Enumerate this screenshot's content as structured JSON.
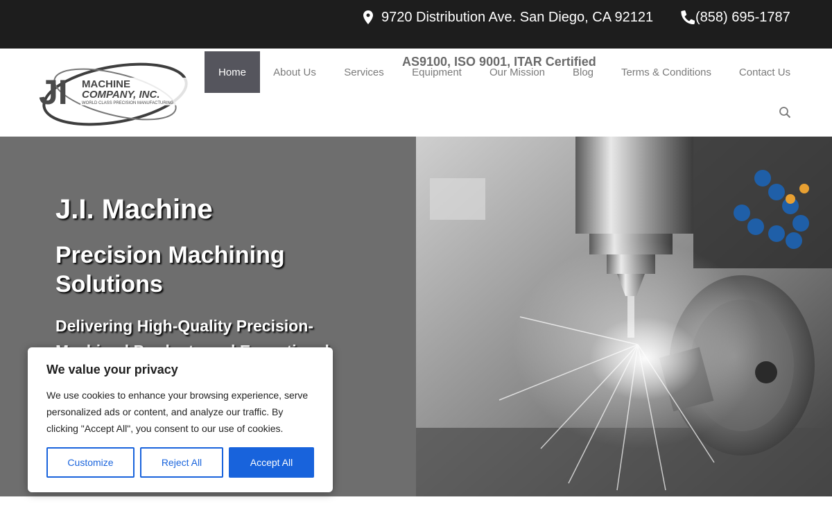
{
  "topbar": {
    "address": "9720 Distribution Ave. San Diego, CA 92121",
    "phone": "(858) 695-1787"
  },
  "header": {
    "certification": "AS9100, ISO 9001, ITAR Certified",
    "logo": {
      "initials": "JI",
      "line1": "MACHINE",
      "line2": "COMPANY, INC.",
      "tagline": "WORLD CLASS PRECISION MANUFACTURING"
    },
    "nav": [
      {
        "label": "Home",
        "active": true
      },
      {
        "label": "About Us"
      },
      {
        "label": "Services"
      },
      {
        "label": "Equipment"
      },
      {
        "label": "Our Mission"
      },
      {
        "label": "Blog"
      },
      {
        "label": "Terms & Conditions"
      },
      {
        "label": "Contact Us"
      }
    ]
  },
  "hero": {
    "title": "J.I. Machine",
    "subtitle": "Precision Machining Solutions",
    "tagline": "Delivering High-Quality Precision-Machined Products and Exceptional"
  },
  "cookie_banner": {
    "title": "We value your privacy",
    "body": "We use cookies to enhance your browsing experience, serve personalized ads or content, and analyze our traffic. By clicking \"Accept All\", you consent to our use of cookies.",
    "customize_label": "Customize",
    "reject_label": "Reject All",
    "accept_label": "Accept All"
  },
  "colors": {
    "topbar_bg": "#1d1d1d",
    "nav_active_bg": "#55555d",
    "hero_left_bg": "#6e6e6e",
    "accent": "#1863dc"
  },
  "icons": [
    "map-pin-icon",
    "phone-icon",
    "search-icon"
  ]
}
